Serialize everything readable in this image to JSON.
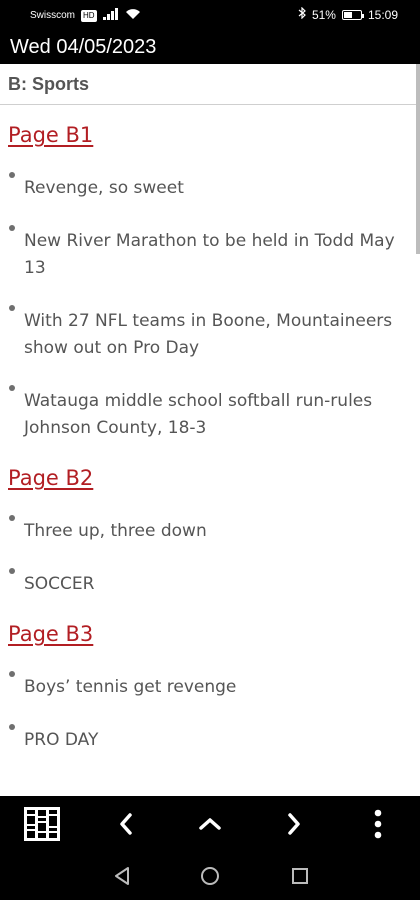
{
  "status_bar": {
    "carrier": "Swisscom",
    "volte": "HD",
    "battery_percent": "51%",
    "battery_level": 0.51,
    "time": "15:09"
  },
  "header": {
    "date": "Wed 04/05/2023"
  },
  "section": {
    "title": "B: Sports"
  },
  "pages": [
    {
      "heading": "Page B1",
      "items": [
        "Revenge, so sweet",
        "New River Marathon to be held in Todd May 13",
        "With 27 NFL teams in Boone, Mountaineers show  out on Pro Day",
        "Watauga middle school softball run-rules Johnson  County, 18-3"
      ]
    },
    {
      "heading": "Page B2",
      "items": [
        "Three up, three down",
        "SOCCER"
      ]
    },
    {
      "heading": "Page B3",
      "items": [
        "Boys’ tennis get revenge",
        "PRO DAY"
      ]
    }
  ],
  "toolbar": {
    "icons": [
      "newspaper-pages-icon",
      "chevron-left-icon",
      "chevron-up-icon",
      "chevron-right-icon",
      "more-vertical-icon"
    ]
  },
  "system_nav": {
    "icons": [
      "back-triangle-icon",
      "home-circle-icon",
      "recents-square-icon"
    ]
  },
  "colors": {
    "accent": "#b21e23",
    "text": "#555555",
    "bars": "#000000"
  }
}
